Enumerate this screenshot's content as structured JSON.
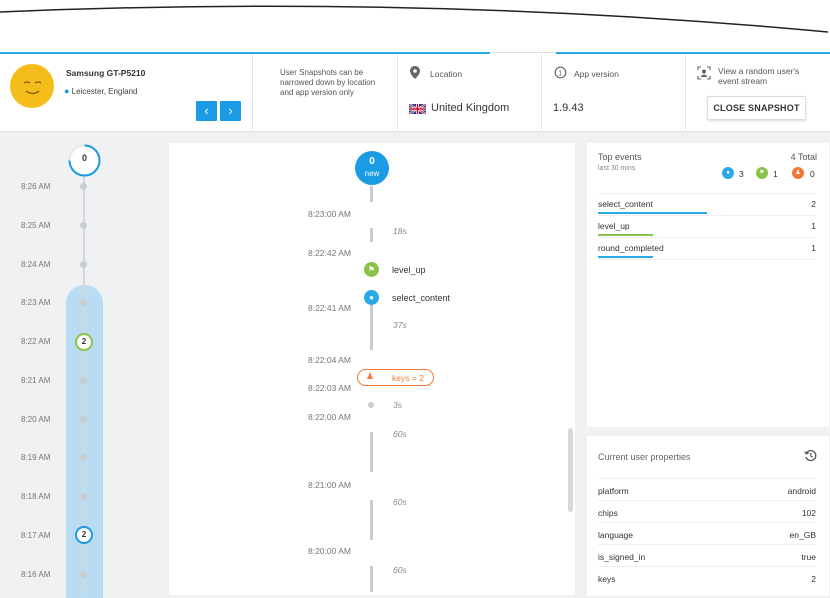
{
  "header": {
    "device_name": "Samsung GT-P5210",
    "device_location": "Leicester, England",
    "prev_label": "‹",
    "next_label": "›",
    "snapshot_note": "User Snapshots can be narrowed down by location and app version only",
    "location_label": "Location",
    "location_value": "United Kingdom",
    "app_version_label": "App version",
    "app_version_value": "1.9.43",
    "random_stream_label": "View a random user's event stream",
    "close_snapshot_label": "CLOSE SNAPSHOT"
  },
  "left_timeline": {
    "top_badge": "0",
    "times": [
      "8:26 AM",
      "8:25 AM",
      "8:24 AM",
      "8:23 AM",
      "8:22 AM",
      "8:21 AM",
      "8:20 AM",
      "8:19 AM",
      "8:18 AM",
      "8:17 AM",
      "8:16 AM"
    ],
    "badges": [
      {
        "time": "8:22 AM",
        "count": "2"
      },
      {
        "time": "8:17 AM",
        "count": "2"
      }
    ]
  },
  "stream": {
    "top_count": "0",
    "top_label": "new",
    "timestamps": [
      "8:23:00 AM",
      "8:22:42 AM",
      "8:22:41 AM",
      "8:22:04 AM",
      "8:22:03 AM",
      "8:22:00 AM",
      "8:21:00 AM",
      "8:20:00 AM"
    ],
    "durations": [
      "18s",
      "37s",
      "3s",
      "60s",
      "60s",
      "60s"
    ],
    "events": [
      {
        "name": "level_up",
        "icon": "flag-icon"
      },
      {
        "name": "select_content",
        "icon": "user-icon"
      }
    ],
    "property_change": "keys = 2"
  },
  "top_events": {
    "title": "Top events",
    "total": "4 Total",
    "subtitle": "last 30 mins",
    "counts": {
      "blue": "3",
      "green": "1",
      "orange": "0"
    },
    "rows": [
      {
        "name": "select_content",
        "count": "2"
      },
      {
        "name": "level_up",
        "count": "1"
      },
      {
        "name": "round_completed",
        "count": "1"
      }
    ]
  },
  "user_properties": {
    "title": "Current user properties",
    "rows": [
      {
        "name": "platform",
        "value": "android"
      },
      {
        "name": "chips",
        "value": "102"
      },
      {
        "name": "language",
        "value": "en_GB"
      },
      {
        "name": "is_signed_in",
        "value": "true"
      },
      {
        "name": "keys",
        "value": "2"
      }
    ]
  },
  "colors": {
    "accent": "#1a9be3",
    "green": "#8bc34a",
    "orange": "#f0793a",
    "avatar": "#f5bd19"
  }
}
